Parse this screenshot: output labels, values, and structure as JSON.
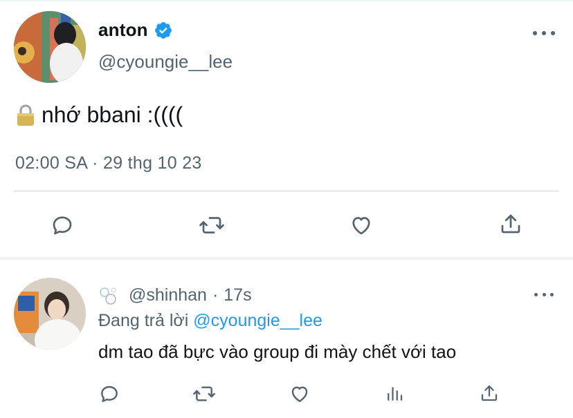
{
  "main_tweet": {
    "display_name": "anton",
    "handle": "@cyoungie__lee",
    "text": "nhớ bbani :((((",
    "timestamp": "02:00 SA · 29 thg 10 23",
    "verified_icon": "verified-badge-icon",
    "lock_icon": "lock-emoji-icon"
  },
  "reply": {
    "handle": "@shinhan",
    "separator": "·",
    "time": "17s",
    "replying_prefix": "Đang trả lời ",
    "replying_to": "@cyoungie__lee",
    "text": "dm tao đã bực vào group đi mày chết với tao",
    "profile_icon": "bubbles-emoji-icon"
  },
  "actions_main": [
    "reply-icon",
    "retweet-icon",
    "like-icon",
    "share-icon"
  ],
  "actions_reply": [
    "reply-icon",
    "retweet-icon",
    "like-icon",
    "analytics-icon",
    "share-icon"
  ],
  "colors": {
    "text": "#0f1419",
    "secondary": "#536471",
    "accent": "#1d9bf0",
    "divider": "#cfd9de"
  }
}
